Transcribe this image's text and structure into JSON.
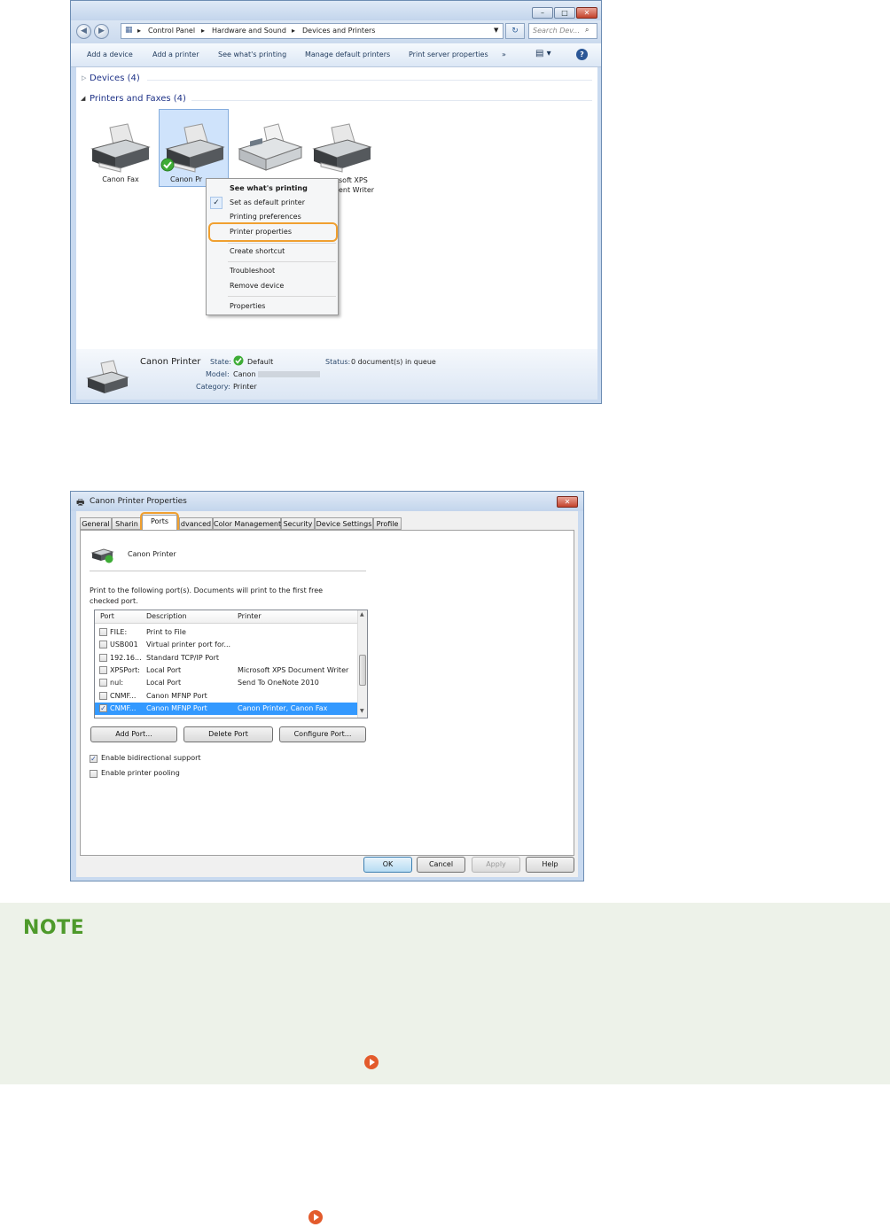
{
  "explorer": {
    "breadcrumb": [
      "Control Panel",
      "Hardware and Sound",
      "Devices and Printers"
    ],
    "search_placeholder": "Search Dev...",
    "commands": [
      "Add a device",
      "Add a printer",
      "See what's printing",
      "Manage default printers",
      "Print server properties",
      "»"
    ],
    "groups": {
      "devices": "Devices (4)",
      "printers": "Printers and Faxes (4)"
    },
    "printers": [
      {
        "label": "Canon Fax"
      },
      {
        "label": "Canon Pr"
      },
      {
        "label": ""
      },
      {
        "label": "soft XPS\nent Writer"
      }
    ],
    "context_menu": {
      "items": [
        "See what's printing",
        "Set as default printer",
        "Printing preferences",
        "Printer properties",
        "Create shortcut",
        "Troubleshoot",
        "Remove device",
        "Properties"
      ],
      "highlighted": "Printer properties"
    },
    "details": {
      "name": "Canon Printer",
      "state_label": "State:",
      "state_value": "Default",
      "status_label": "Status:",
      "status_value": "0 document(s) in queue",
      "model_label": "Model:",
      "model_value": "Canon",
      "category_label": "Category:",
      "category_value": "Printer"
    }
  },
  "dialog": {
    "title": "Canon Printer Properties",
    "tabs": [
      "General",
      "Sharin",
      "Ports",
      "dvanced",
      "Color Management",
      "Security",
      "Device Settings",
      "Profile"
    ],
    "active_tab": "Ports",
    "printer_name": "Canon Printer",
    "instruction_line1": "Print to the following port(s). Documents will print to the first free",
    "instruction_line2": "checked port.",
    "port_columns": [
      "Port",
      "Description",
      "Printer"
    ],
    "ports": [
      {
        "port": "FILE:",
        "description": "Print to File",
        "printer": "",
        "checked": false,
        "selected": false
      },
      {
        "port": "USB001",
        "description": "Virtual printer port for...",
        "printer": "",
        "checked": false,
        "selected": false
      },
      {
        "port": "192.16...",
        "description": "Standard TCP/IP Port",
        "printer": "",
        "checked": false,
        "selected": false
      },
      {
        "port": "XPSPort:",
        "description": "Local Port",
        "printer": "Microsoft XPS Document Writer",
        "checked": false,
        "selected": false
      },
      {
        "port": "nul:",
        "description": "Local Port",
        "printer": "Send To OneNote 2010",
        "checked": false,
        "selected": false
      },
      {
        "port": "CNMF...",
        "description": "Canon MFNP Port",
        "printer": "",
        "checked": false,
        "selected": false
      },
      {
        "port": "CNMF...",
        "description": "Canon MFNP Port",
        "printer": "Canon Printer, Canon Fax",
        "checked": true,
        "selected": true
      }
    ],
    "port_buttons": [
      "Add Port...",
      "Delete Port",
      "Configure Port..."
    ],
    "options": [
      {
        "label": "Enable bidirectional support",
        "checked": true
      },
      {
        "label": "Enable printer pooling",
        "checked": false
      }
    ],
    "footer_buttons": [
      "OK",
      "Cancel",
      "Apply",
      "Help"
    ]
  },
  "note": {
    "title": "NOTE"
  },
  "colors": {
    "note_bg": "#edf2e9",
    "note_title": "#4e9a2b",
    "highlight_ring": "#f0a030",
    "link_icon": "#e35b2c",
    "selection": "#3399ff"
  }
}
